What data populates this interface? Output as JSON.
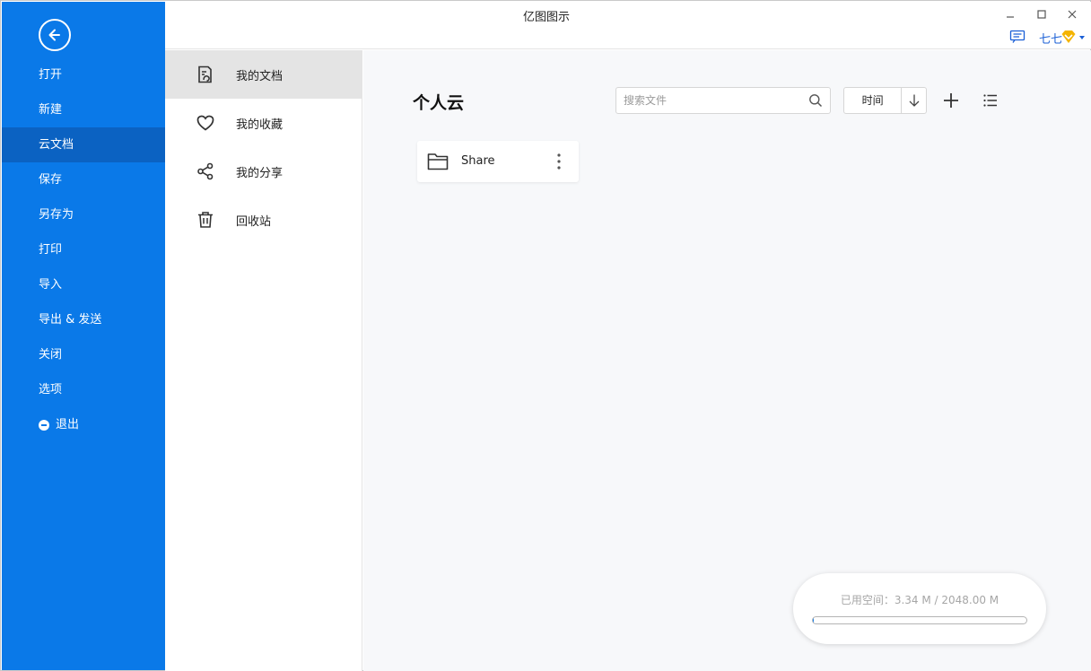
{
  "window": {
    "title": "亿图图示"
  },
  "user": {
    "name": "七七"
  },
  "sidebar": {
    "items": [
      {
        "label": "打开"
      },
      {
        "label": "新建"
      },
      {
        "label": "云文档",
        "active": true
      },
      {
        "label": "保存"
      },
      {
        "label": "另存为"
      },
      {
        "label": "打印"
      },
      {
        "label": "导入"
      },
      {
        "label": "导出 & 发送"
      },
      {
        "label": "关闭"
      },
      {
        "label": "选项"
      },
      {
        "label": "退出"
      }
    ]
  },
  "subnav": {
    "items": [
      {
        "label": "我的文档",
        "icon": "document-icon",
        "active": true
      },
      {
        "label": "我的收藏",
        "icon": "heart-icon"
      },
      {
        "label": "我的分享",
        "icon": "share-icon"
      },
      {
        "label": "回收站",
        "icon": "trash-icon"
      }
    ]
  },
  "main": {
    "title": "个人云",
    "search_placeholder": "搜索文件",
    "sort_label": "时间",
    "folders": [
      {
        "name": "Share"
      }
    ]
  },
  "storage": {
    "text": "已用空间：3.34 M / 2048.00 M",
    "used_mb": 3.34,
    "total_mb": 2048.0
  },
  "colors": {
    "sidebar": "#0a79e8",
    "sidebar_active": "#0b62c2",
    "accent": "#1a5fd6"
  }
}
